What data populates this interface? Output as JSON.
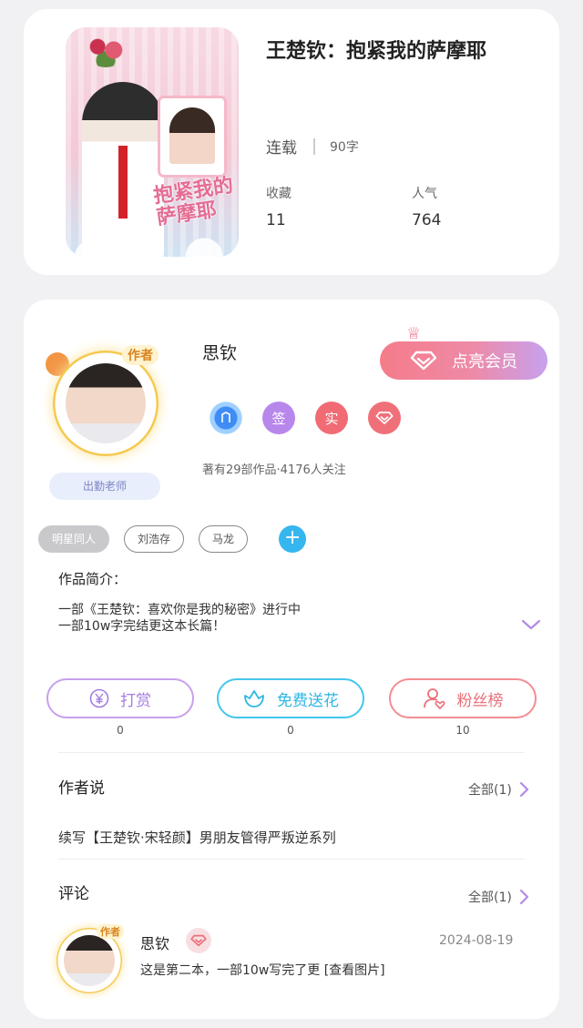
{
  "book": {
    "title": "王楚钦：抱紧我的萨摩耶",
    "cover_text": "抱紧我的萨摩耶",
    "status": "连载",
    "word_count": "90字",
    "favorites_label": "收藏",
    "favorites": "11",
    "popularity_label": "人气",
    "popularity": "764"
  },
  "author": {
    "avatar_tag": "作者",
    "title_badge": "出勤老师",
    "name": "思钦",
    "vip_button": "点亮会员",
    "badges": {
      "sign": "签",
      "real": "实"
    },
    "stats": "著有29部作品·4176人关注"
  },
  "tags": [
    "明星同人",
    "刘浩存",
    "马龙"
  ],
  "tag_add": "+",
  "intro": {
    "title": "作品简介：",
    "line1": "一部《王楚钦：喜欢你是我的秘密》进行中",
    "line2": "一部10w字完结更这本长篇！"
  },
  "actions": {
    "reward": {
      "label": "打赏",
      "count": "0"
    },
    "flower": {
      "label": "免费送花",
      "count": "0"
    },
    "fans": {
      "label": "粉丝榜",
      "count": "10"
    }
  },
  "author_says": {
    "title": "作者说",
    "all": "全部(1)",
    "content": "续写【王楚钦·宋轻颜】男朋友管得严叛逆系列"
  },
  "comments": {
    "title": "评论",
    "all": "全部(1)",
    "items": [
      {
        "avatar_tag": "作者",
        "name": "思钦",
        "date": "2024-08-19",
        "text": "这是第二本，一部10w写完了更 [查看图片]"
      }
    ]
  },
  "colors": {
    "accent_purple": "#b887ec",
    "accent_blue": "#45c7ec",
    "accent_red": "#ea7079",
    "vip_gradient_start": "#f57c8a",
    "vip_gradient_end": "#c7a1ee"
  }
}
